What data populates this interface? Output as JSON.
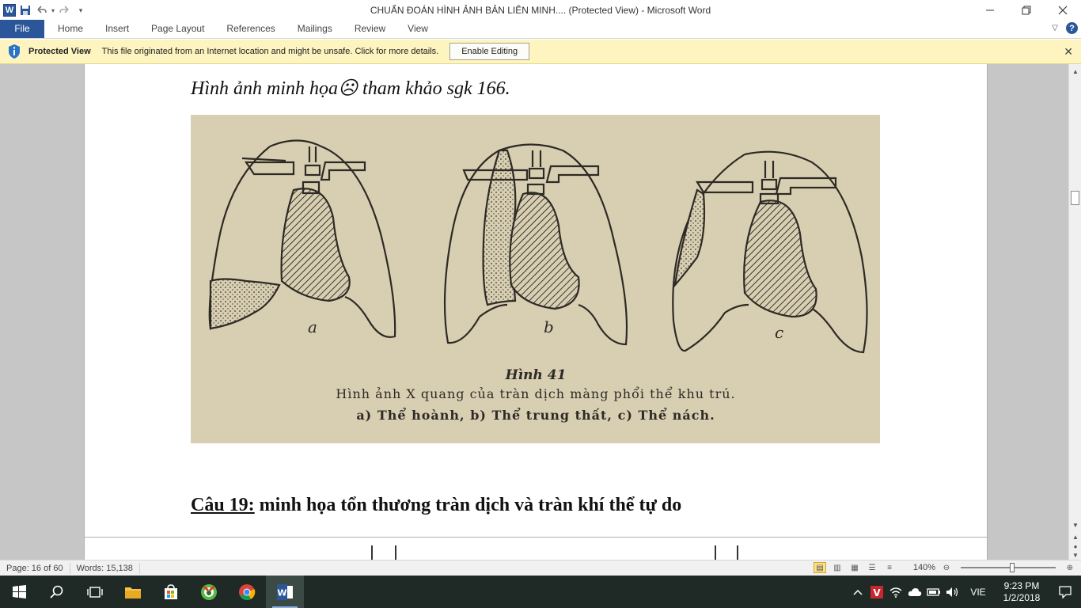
{
  "window": {
    "title": "CHUẨN ĐOÁN HÌNH ẢNH BẢN LIÊN MINH.... (Protected View)  -  Microsoft Word"
  },
  "quick_access": {
    "app_icon": "word-logo-icon",
    "app_letter": "W",
    "items": [
      "save-icon",
      "undo-icon",
      "redo-icon",
      "customize-icon"
    ]
  },
  "ribbon": {
    "tabs": [
      "File",
      "Home",
      "Insert",
      "Page Layout",
      "References",
      "Mailings",
      "Review",
      "View"
    ],
    "help_label": "?"
  },
  "protected_view": {
    "title": "Protected View",
    "message": "This file originated from an Internet location and might be unsafe. Click for more details.",
    "button_label": "Enable Editing",
    "close_label": "✕"
  },
  "document": {
    "caption_line": "Hình ảnh minh họa☹ tham khảo sgk 166.",
    "figure": {
      "labels": [
        "a",
        "b",
        "c"
      ],
      "title": "Hình 41",
      "line1": "Hình ảnh X quang của tràn dịch màng phổi thể khu trú.",
      "line2": "a) Thể  hoành, b) Thể trung thất, c) Thể nách."
    },
    "heading_num": "Câu 19:",
    "heading_text": " minh họa tổn thương tràn dịch và tràn khí thể tự do"
  },
  "status_bar": {
    "page": "Page: 16 of 60",
    "words": "Words: 15,138",
    "zoom": "140%",
    "zoom_level_percent": 140
  },
  "taskbar": {
    "apps": [
      "start-icon",
      "search-icon",
      "task-view-icon",
      "file-explorer-icon",
      "store-icon",
      "coccoc-browser-icon",
      "chrome-icon",
      "word-icon"
    ],
    "language": "VIE",
    "time": "9:23 PM",
    "date": "1/2/2018"
  },
  "colors": {
    "accent": "#2b579a",
    "protected_bar": "#fdf4bf",
    "document_bg": "#c6c6c6",
    "figure_paper": "#d8cfb3",
    "taskbar": "#1f2a26"
  }
}
